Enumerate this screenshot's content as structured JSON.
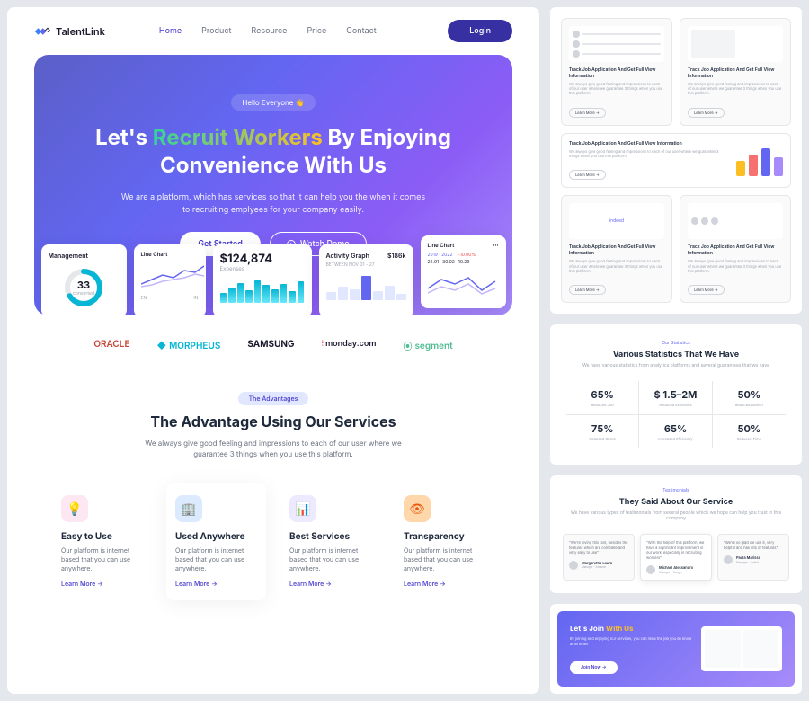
{
  "nav": {
    "brand": "TalentLink",
    "links": {
      "home": "Home",
      "product": "Product",
      "resource": "Resource",
      "price": "Price",
      "contact": "Contact"
    },
    "login": "Login"
  },
  "hero": {
    "badge": "Hello Everyone 👋",
    "title_1": "Let's",
    "title_gradient": "Recruit Workers",
    "title_2": "By Enjoying",
    "title_3": "Convenience With Us",
    "sub": "We are a platform, which has services so that it can help you the when it comes to recruiting emplyees for your company easily.",
    "cta_primary": "Get Started",
    "cta_secondary": "Watch Demo"
  },
  "dash": {
    "management": {
      "title": "Management",
      "value": "33",
      "label": "converted"
    },
    "linechart": {
      "title": "Line Chart",
      "left": "EN",
      "right": "IN"
    },
    "expenses": {
      "amount": "$124,874",
      "label": "Expenses"
    },
    "activity": {
      "title": "Activity Graph",
      "amount": "$186k",
      "sub": "BETWEEN NOV 01 - 27"
    },
    "forecast": {
      "title": "Line Chart",
      "years": "2019 · 2022",
      "change": "-10.00%",
      "v1": "22.91",
      "v2": "30.02",
      "v3": "10.29"
    }
  },
  "brands": {
    "oracle": "ORACLE",
    "morpheus": "MORPHEUS",
    "samsung": "SAMSUNG",
    "monday": "monday.com",
    "segment": "segment"
  },
  "advantages": {
    "badge": "The Advantages",
    "title": "The Advantage Using Our Services",
    "sub": "We always give good feeling and impressions to each of our user where we guarantee 3 things when you use this platform.",
    "items": [
      {
        "icon": "💡",
        "title": "Easy to Use",
        "desc": "Our platform is internet based that you can use anywhere.",
        "link": "Learn More →"
      },
      {
        "icon": "🏢",
        "title": "Used Anywhere",
        "desc": "Our platform is internet based that you can use anywhere.",
        "link": "Learn More →"
      },
      {
        "icon": "📊",
        "title": "Best Services",
        "desc": "Our platform is internet based that you can use anywhere.",
        "link": "Learn More →"
      },
      {
        "icon": "👁",
        "title": "Transparency",
        "desc": "Our platform is internet based that you can use anywhere.",
        "link": "Learn More →"
      }
    ]
  },
  "features": {
    "card_title": "Track Job Application And Get Full View Information",
    "card_desc": "We always give good feeling and impressions to each of our user where we guarantee 3 things when you use this platform.",
    "learn": "Learn More →"
  },
  "stats": {
    "badge": "Our Statistics",
    "title": "Various Statistics That We Have",
    "sub": "We have various statistics from analytics platforms and several guarantees that we have",
    "items": [
      {
        "value": "65%",
        "label": "Reduced Job"
      },
      {
        "value": "$ 1.5–2M",
        "label": "Reduced Expenses"
      },
      {
        "value": "50%",
        "label": "Reduced Search"
      },
      {
        "value": "75%",
        "label": "Reduced Clicks"
      },
      {
        "value": "65%",
        "label": "Increased Efficiency"
      },
      {
        "value": "50%",
        "label": "Reduced Time"
      }
    ]
  },
  "testimonials": {
    "badge": "Testimonials",
    "title": "They Said About Our Service",
    "sub": "We have various types of testimonials from several people which we hope can help you trust in this company",
    "items": [
      {
        "name": "Margaretha Laura",
        "role": "Manager - Amazon"
      },
      {
        "name": "Michael Alessandro",
        "role": "Manager - Google"
      },
      {
        "name": "Paula Marissa",
        "role": "Manager - Twitch"
      }
    ]
  },
  "cta": {
    "title_1": "Let's Join",
    "title_2": "With Us",
    "desc": "By joining and enjoying our services, you can relax the job you do know at all times",
    "btn": "Join Now →"
  }
}
